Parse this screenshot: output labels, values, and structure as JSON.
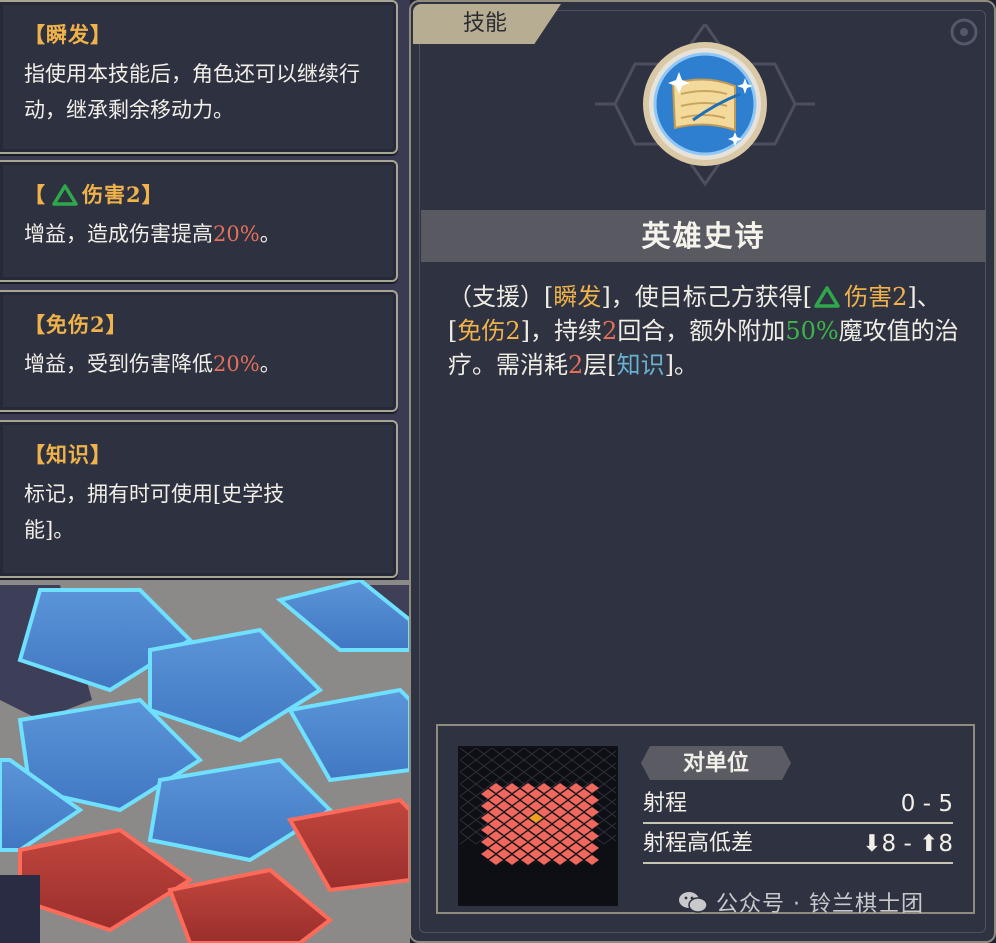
{
  "tooltips": [
    {
      "title": "【瞬发】",
      "body": "指使用本技能后，角色还可以继续行动，继承剩余移动力。"
    },
    {
      "title_prefix": "【",
      "title_icon": "green-triangle-icon",
      "title": "伤害2】",
      "body_prefix": "增益，造成伤害提高",
      "body_value": "20%",
      "body_suffix": "。"
    },
    {
      "title": "【免伤2】",
      "body_prefix": "增益，受到伤害降低",
      "body_value": "20%",
      "body_suffix": "。"
    },
    {
      "title": "【知识】",
      "body": "标记，拥有时可使用[史学技能]。"
    }
  ],
  "panel": {
    "tab": "技能",
    "icon": "scroll-icon",
    "skill_name": "英雄史诗",
    "desc": {
      "p1": "（支援）[",
      "k1": "瞬发",
      "p2": "]，使目标己方获得[",
      "k2": "伤害2",
      "p3": "]、[",
      "k3": "免伤2",
      "p4": "]，持续",
      "n1": "2",
      "p5": "回合，额外附加",
      "n2": "50%",
      "p6": "魔攻值的治疗。需消耗",
      "n3": "2",
      "p7": "层[",
      "k4": "知识",
      "p8": "]。"
    },
    "range": {
      "target": "对单位",
      "range_label": "射程",
      "range_value": "0 - 5",
      "height_label": "射程高低差",
      "height_value": "⬇8 - ⬆8"
    }
  },
  "watermark": "公众号 · 铃兰棋士团",
  "colors": {
    "keyword": "#f0b24a",
    "percent": "#e2705a",
    "heal": "#3cb44b",
    "mark": "#6ab0cf",
    "range_tile": "#f0675d",
    "center_tile": "#f0a020"
  }
}
